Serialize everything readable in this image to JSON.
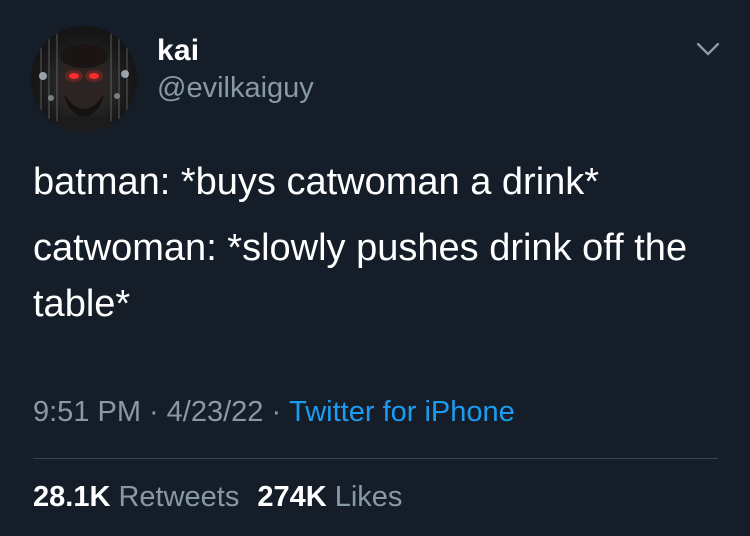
{
  "author": {
    "display_name": "kai",
    "handle": "@evilkaiguy",
    "avatar_icon": "user-avatar"
  },
  "tweet": {
    "lines": [
      "batman: *buys catwoman a drink*",
      "catwoman: *slowly pushes drink off the table*"
    ]
  },
  "meta": {
    "time": "9:51 PM",
    "separator": "·",
    "date": "4/23/22",
    "source": "Twitter for iPhone"
  },
  "stats": {
    "retweets_count": "28.1K",
    "retweets_label": "Retweets",
    "likes_count": "274K",
    "likes_label": "Likes"
  },
  "colors": {
    "background": "#151d28",
    "secondary_text": "#8899a6",
    "link": "#1d9bf0",
    "divider": "#38444d"
  },
  "icons": {
    "menu": "chevron-down-icon"
  }
}
